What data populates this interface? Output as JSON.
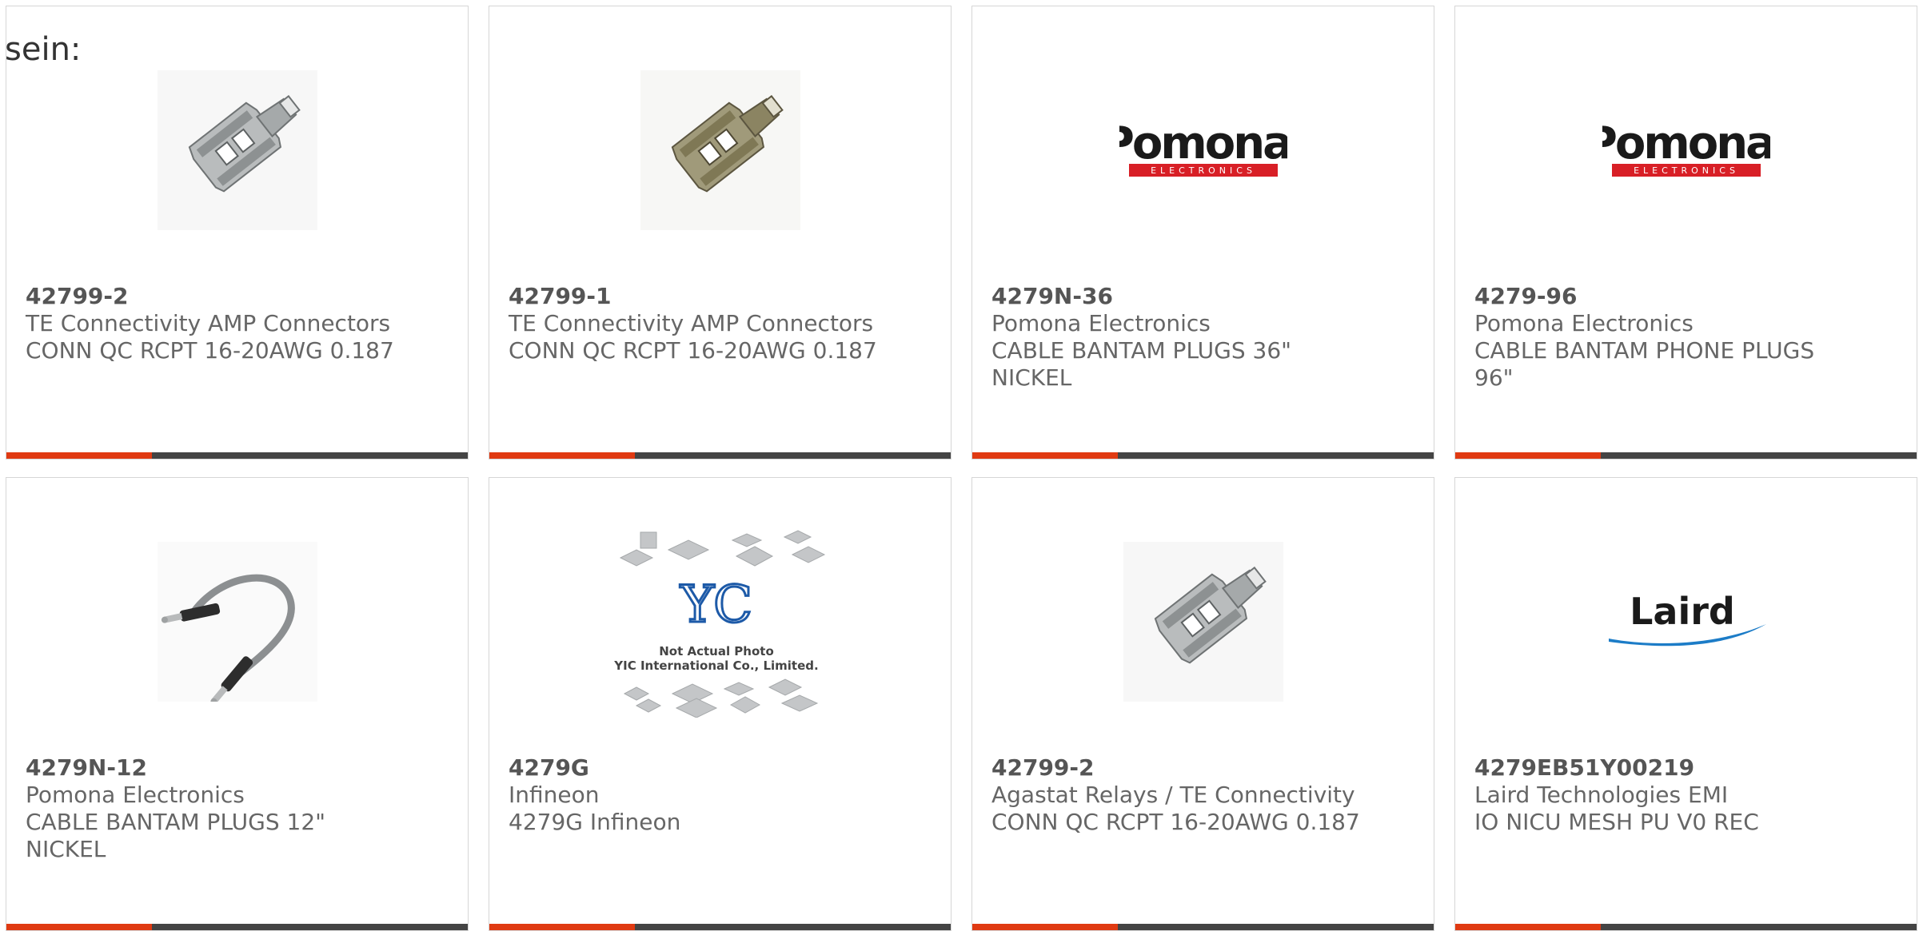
{
  "lead_text": "sein:",
  "colors": {
    "accent_bar": "#e03a12",
    "bar_base": "#444444",
    "card_border": "#d6d6d6",
    "pomona_red": "#d81f26",
    "laird_blue": "#1c7cc7"
  },
  "cards": [
    {
      "part": "42799-2",
      "manufacturer": "TE Connectivity AMP Connectors",
      "description": "CONN QC RCPT 16-20AWG 0.187",
      "image": "quick-connect-receptacle-photo"
    },
    {
      "part": "42799-1",
      "manufacturer": "TE Connectivity AMP Connectors",
      "description": "CONN QC RCPT 16-20AWG 0.187",
      "image": "quick-connect-receptacle-brass-photo"
    },
    {
      "part": "4279N-36",
      "manufacturer": "Pomona Electronics",
      "description": "CABLE BANTAM PLUGS 36\"\nNICKEL",
      "image": "pomona-logo",
      "logo_text": "Pomona.",
      "logo_subtext": "ELECTRONICS"
    },
    {
      "part": "4279-96",
      "manufacturer": "Pomona Electronics",
      "description": "CABLE BANTAM PHONE PLUGS\n96\"",
      "image": "pomona-logo",
      "logo_text": "Pomona.",
      "logo_subtext": "ELECTRONICS"
    },
    {
      "part": "4279N-12",
      "manufacturer": "Pomona Electronics",
      "description": "CABLE BANTAM PLUGS 12\"\nNICKEL",
      "image": "bantam-cable-photo"
    },
    {
      "part": "4279G",
      "manufacturer": "Infineon",
      "description": "4279G Infineon",
      "image": "yic-placeholder",
      "placeholder_line1": "Not Actual Photo",
      "placeholder_line2": "YIC International Co., Limited."
    },
    {
      "part": "42799-2",
      "manufacturer": "Agastat Relays / TE Connectivity",
      "description": "CONN QC RCPT 16-20AWG 0.187",
      "image": "quick-connect-receptacle-photo"
    },
    {
      "part": "4279EB51Y00219",
      "manufacturer": "Laird Technologies EMI",
      "description": "IO NICU MESH PU V0 REC",
      "image": "laird-logo",
      "logo_text": "Laird"
    }
  ]
}
